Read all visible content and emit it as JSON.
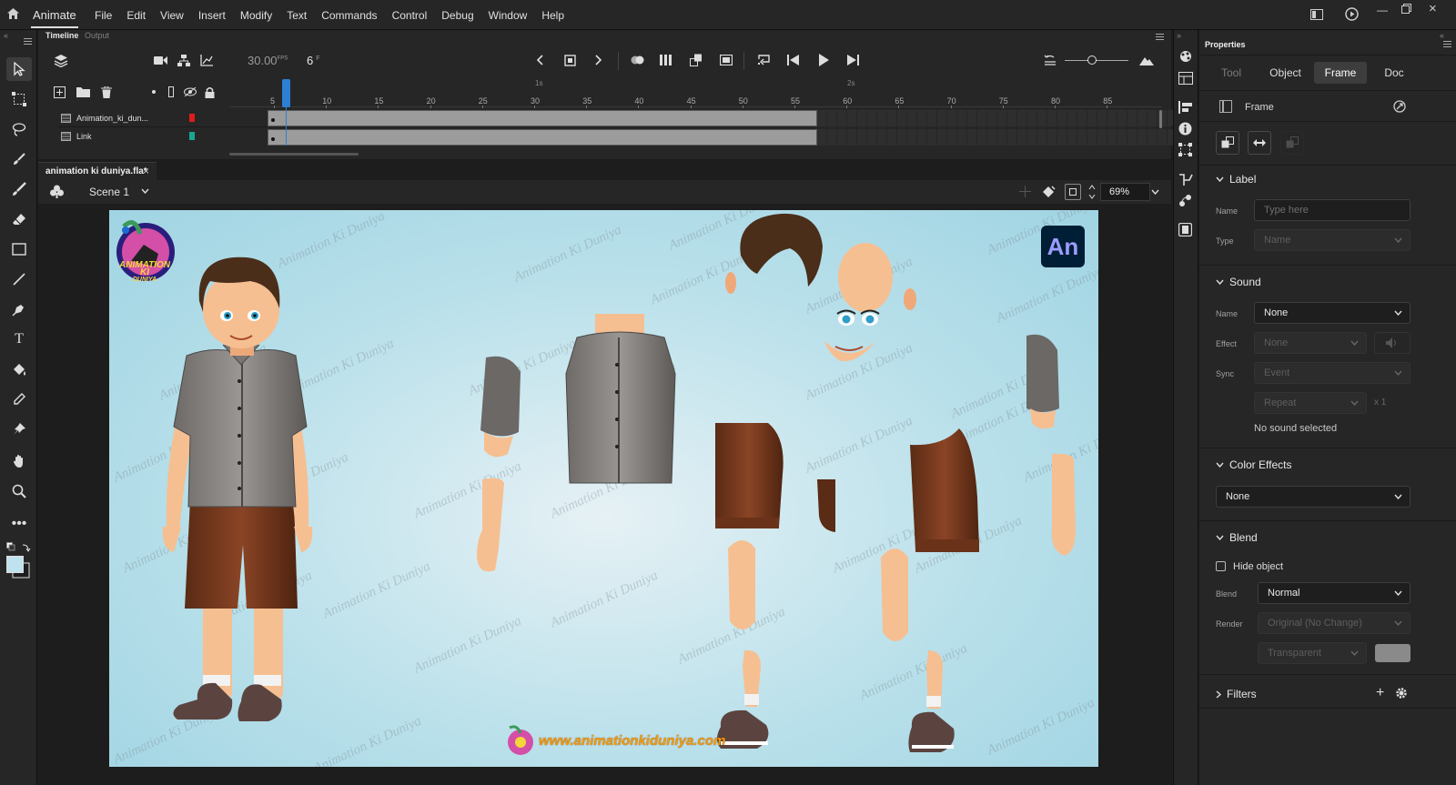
{
  "app": {
    "name": "Animate"
  },
  "menu": [
    "File",
    "Edit",
    "View",
    "Insert",
    "Modify",
    "Text",
    "Commands",
    "Control",
    "Debug",
    "Window",
    "Help"
  ],
  "timeline": {
    "tabs": [
      "Timeline",
      "Output"
    ],
    "fps": "30.00",
    "fps_unit": "FPS",
    "frame": "6",
    "frame_unit": "F",
    "ruler": [
      "5",
      "10",
      "15",
      "20",
      "25",
      "30",
      "35",
      "40",
      "45",
      "50",
      "55",
      "60",
      "65",
      "70",
      "75",
      "80",
      "85"
    ],
    "seconds": [
      "1s",
      "2s"
    ],
    "playhead_frame": 6,
    "layers": [
      {
        "name": "Animation_ki_dun...",
        "color": "#e01b1b"
      },
      {
        "name": "Link",
        "color": "#17a590"
      }
    ]
  },
  "document": {
    "tab": "animation ki duniya.fla*",
    "close": "×",
    "scene": "Scene 1",
    "zoom": "69%"
  },
  "stage": {
    "watermark": "Animation Ki Duniya",
    "url": "www.animationkiduniya.com",
    "badge": "An",
    "logo_lines": [
      "ANIMATION",
      "KI",
      "DUNIYA"
    ]
  },
  "properties": {
    "title": "Properties",
    "tabs": [
      "Tool",
      "Object",
      "Frame",
      "Doc"
    ],
    "active_tab": "Frame",
    "frame_header": "Frame",
    "label": {
      "heading": "Label",
      "name_label": "Name",
      "name_placeholder": "Type here",
      "type_label": "Type",
      "type_value": "Name"
    },
    "sound": {
      "heading": "Sound",
      "name_label": "Name",
      "name_value": "None",
      "effect_label": "Effect",
      "effect_value": "None",
      "sync_label": "Sync",
      "sync_value": "Event",
      "repeat_value": "Repeat",
      "repeat_count": "x 1",
      "status": "No sound selected"
    },
    "color_effects": {
      "heading": "Color Effects",
      "value": "None"
    },
    "blend": {
      "heading": "Blend",
      "hide_object": "Hide object",
      "blend_label": "Blend",
      "blend_value": "Normal",
      "render_label": "Render",
      "render_value": "Original (No Change)",
      "transparent_value": "Transparent"
    },
    "filters": {
      "heading": "Filters"
    }
  }
}
